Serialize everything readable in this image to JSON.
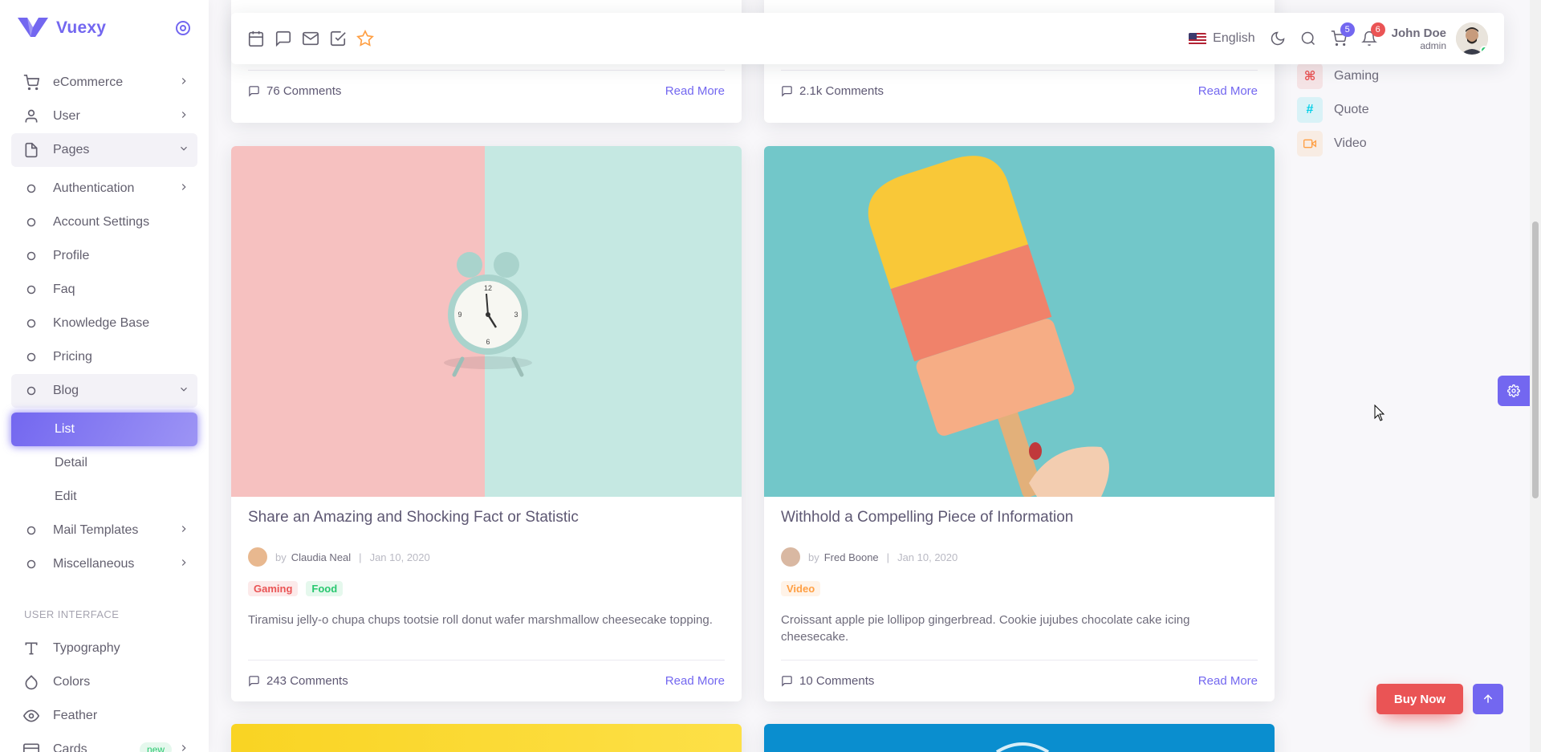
{
  "brand": {
    "name": "Vuexy"
  },
  "sidebar": {
    "items": [
      {
        "label": "eCommerce",
        "icon": "cart-icon"
      },
      {
        "label": "User",
        "icon": "user-icon"
      },
      {
        "label": "Pages",
        "icon": "file-icon"
      },
      {
        "label": "Authentication",
        "icon": "circle-icon"
      },
      {
        "label": "Account Settings",
        "icon": "circle-icon"
      },
      {
        "label": "Profile",
        "icon": "circle-icon"
      },
      {
        "label": "Faq",
        "icon": "circle-icon"
      },
      {
        "label": "Knowledge Base",
        "icon": "circle-icon"
      },
      {
        "label": "Pricing",
        "icon": "circle-icon"
      },
      {
        "label": "Blog",
        "icon": "circle-icon"
      },
      {
        "label": "List"
      },
      {
        "label": "Detail"
      },
      {
        "label": "Edit"
      },
      {
        "label": "Mail Templates",
        "icon": "circle-icon"
      },
      {
        "label": "Miscellaneous",
        "icon": "circle-icon"
      }
    ],
    "section_ui": "USER INTERFACE",
    "ui_items": [
      {
        "label": "Typography",
        "icon": "type-icon"
      },
      {
        "label": "Colors",
        "icon": "droplet-icon"
      },
      {
        "label": "Feather",
        "icon": "eye-icon"
      },
      {
        "label": "Cards",
        "icon": "credit-card-icon",
        "badge": "new"
      }
    ]
  },
  "navbar": {
    "language": "English",
    "cart_count": "5",
    "notification_count": "6",
    "user_name": "John Doe",
    "user_role": "admin"
  },
  "categories": [
    {
      "label": "Gaming",
      "symbol": "⌘",
      "color": "#ea5455"
    },
    {
      "label": "Quote",
      "symbol": "#",
      "color": "#00cfe8"
    },
    {
      "label": "Video",
      "symbol": "▭",
      "color": "#ff9f43"
    }
  ],
  "posts_top": [
    {
      "comments": "76 Comments",
      "read_more": "Read More"
    },
    {
      "comments": "2.1k Comments",
      "read_more": "Read More"
    }
  ],
  "posts": [
    {
      "title": "Share an Amazing and Shocking Fact or Statistic",
      "by": "by",
      "author": "Claudia Neal",
      "date": "Jan 10, 2020",
      "tags": [
        "Gaming",
        "Food"
      ],
      "excerpt": "Tiramisu jelly-o chupa chups tootsie roll donut wafer marshmallow cheesecake topping.",
      "comments": "243 Comments",
      "read_more": "Read More"
    },
    {
      "title": "Withhold a Compelling Piece of Information",
      "by": "by",
      "author": "Fred Boone",
      "date": "Jan 10, 2020",
      "tags": [
        "Video"
      ],
      "excerpt": "Croissant apple pie lollipop gingerbread. Cookie jujubes chocolate cake icing cheesecake.",
      "comments": "10 Comments",
      "read_more": "Read More"
    }
  ],
  "buttons": {
    "buy_now": "Buy Now"
  },
  "colors": {
    "primary": "#7367f0",
    "danger": "#ea5455",
    "success": "#28c76f",
    "warning": "#ff9f43"
  }
}
